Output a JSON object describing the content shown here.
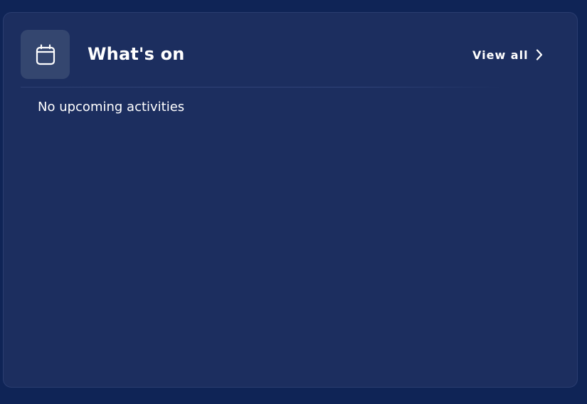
{
  "colors": {
    "page_background": "#0f2456",
    "card_background": "#1c2e5f",
    "icon_box_background": "#34466f",
    "text": "#ffffff"
  },
  "whats_on": {
    "icon": "calendar-icon",
    "title": "What's on",
    "view_all_label": "View all",
    "view_all_icon": "chevron-right-icon",
    "empty_message": "No upcoming activities"
  }
}
